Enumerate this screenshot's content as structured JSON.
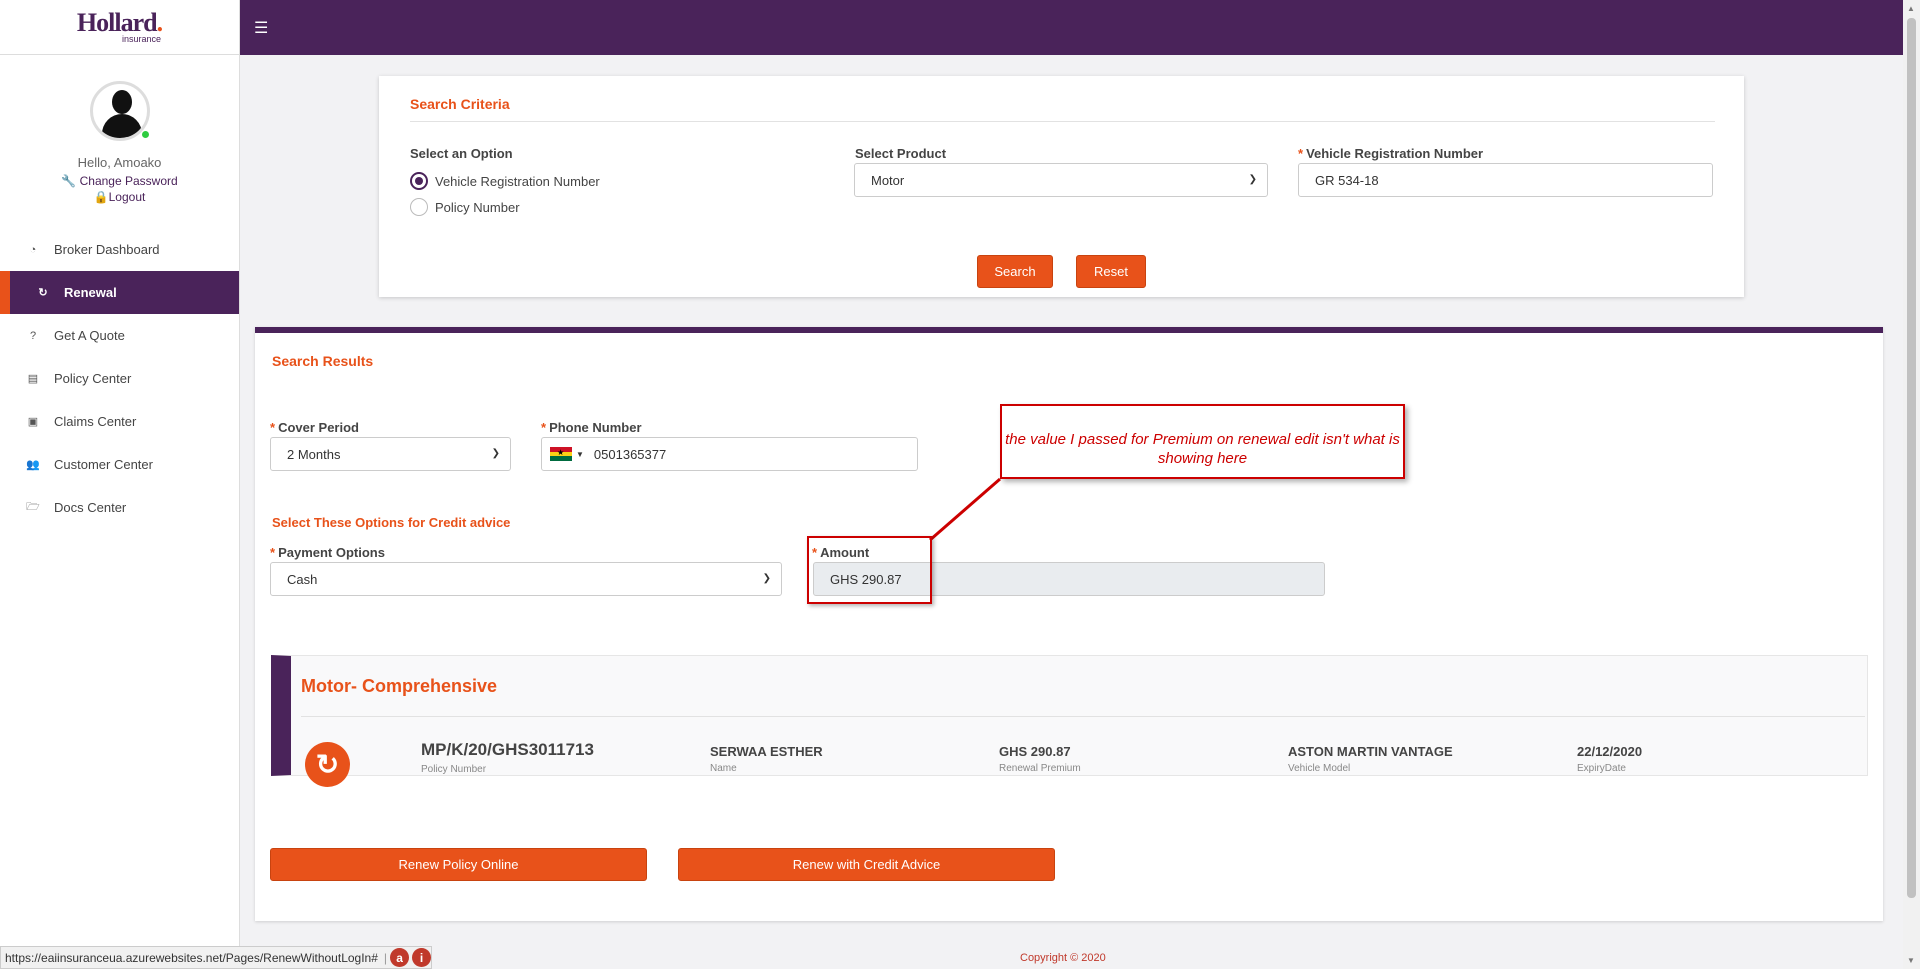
{
  "brand": {
    "name": "Hollard",
    "sub": "insurance"
  },
  "profile": {
    "greeting": "Hello, Amoako",
    "change_password": "Change Password",
    "logout": "Logout"
  },
  "nav": [
    {
      "label": "Broker Dashboard",
      "icon": "dashboard-icon"
    },
    {
      "label": "Renewal",
      "icon": "refresh-icon",
      "active": true
    },
    {
      "label": "Get A Quote",
      "icon": "question-icon"
    },
    {
      "label": "Policy Center",
      "icon": "file-icon"
    },
    {
      "label": "Claims Center",
      "icon": "money-icon"
    },
    {
      "label": "Customer Center",
      "icon": "users-icon"
    },
    {
      "label": "Docs Center",
      "icon": "folder-icon"
    }
  ],
  "search": {
    "title": "Search Criteria",
    "option_label": "Select an Option",
    "options": [
      "Vehicle Registration Number",
      "Policy Number"
    ],
    "selected_option": "Vehicle Registration Number",
    "product_label": "Select Product",
    "product_value": "Motor",
    "reg_label": "Vehicle Registration Number",
    "reg_value": "GR 534-18",
    "search_btn": "Search",
    "reset_btn": "Reset"
  },
  "results": {
    "title": "Search Results",
    "cover_label": "Cover Period",
    "cover_value": "2 Months",
    "phone_label": "Phone Number",
    "phone_value": "0501365377",
    "credit_title": "Select These Options for Credit advice",
    "payment_label": "Payment Options",
    "payment_value": "Cash",
    "amount_label": "Amount",
    "amount_value": "GHS 290.87"
  },
  "policy": {
    "title": "Motor- Comprehensive",
    "number": "MP/K/20/GHS3011713",
    "number_key": "Policy Number",
    "name": "SERWAA ESTHER",
    "name_key": "Name",
    "premium": "GHS 290.87",
    "premium_key": "Renewal Premium",
    "vehicle": "ASTON MARTIN VANTAGE",
    "vehicle_key": "Vehicle Model",
    "expiry": "22/12/2020",
    "expiry_key": "ExpiryDate"
  },
  "actions": {
    "renew_online": "Renew Policy Online",
    "renew_credit": "Renew with Credit Advice"
  },
  "annotation": {
    "text": "the value I passed for Premium on renewal edit isn't what is showing here"
  },
  "footer": {
    "copyright": "Copyright © 2020",
    "status_url": "https://eaiinsuranceua.azurewebsites.net/Pages/RenewWithoutLogIn#"
  },
  "colors": {
    "primary": "#4a235a",
    "accent": "#e8521a",
    "annotation": "#cc0000"
  }
}
